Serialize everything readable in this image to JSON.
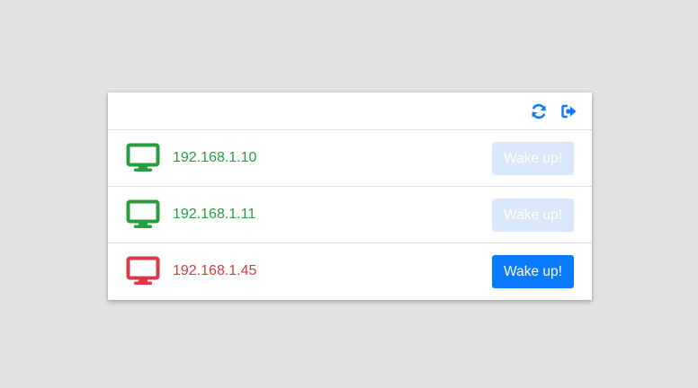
{
  "toolbar": {
    "refresh_icon": "refresh-icon",
    "logout_icon": "sign-out-icon",
    "icon_color": "#0a7bff"
  },
  "hosts": [
    {
      "ip": "192.168.1.10",
      "status": "online",
      "status_color": "#2a9d3e",
      "icon": "desktop-icon",
      "button_label": "Wake up!",
      "button_enabled": false
    },
    {
      "ip": "192.168.1.11",
      "status": "online",
      "status_color": "#2a9d3e",
      "icon": "desktop-icon",
      "button_label": "Wake up!",
      "button_enabled": false
    },
    {
      "ip": "192.168.1.45",
      "status": "offline",
      "status_color": "#d83a45",
      "icon": "desktop-icon",
      "button_label": "Wake up!",
      "button_enabled": true
    }
  ],
  "colors": {
    "button_active": "#0a7bff",
    "button_disabled": "#d9e9fb",
    "online": "#2a9d3e",
    "offline": "#d83a45"
  }
}
